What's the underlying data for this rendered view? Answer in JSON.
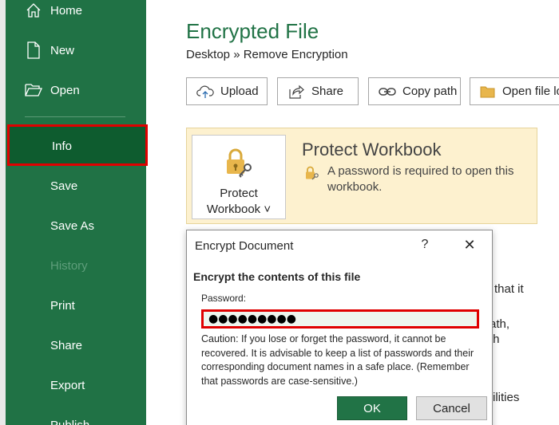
{
  "sidebar": {
    "items": [
      {
        "label": "Home",
        "icon": "home-icon"
      },
      {
        "label": "New",
        "icon": "new-document-icon"
      },
      {
        "label": "Open",
        "icon": "folder-open-icon"
      },
      {
        "label": "Info"
      },
      {
        "label": "Save"
      },
      {
        "label": "Save As"
      },
      {
        "label": "History"
      },
      {
        "label": "Print"
      },
      {
        "label": "Share"
      },
      {
        "label": "Export"
      },
      {
        "label": "Publish"
      }
    ],
    "background": "#207245",
    "selected_background": "#0e5c2f",
    "highlight_color": "#e00000"
  },
  "main": {
    "title": "Encrypted File",
    "breadcrumb": "Desktop » Remove Encryption",
    "actions": [
      {
        "label": "Upload",
        "icon": "cloud-upload-icon"
      },
      {
        "label": "Share",
        "icon": "share-icon"
      },
      {
        "label": "Copy path",
        "icon": "link-icon"
      },
      {
        "label": "Open file location",
        "icon": "folder-icon"
      }
    ],
    "protect": {
      "button_label_line1": "Protect",
      "button_label_line2": "Workbook ˅",
      "heading": "Protect Workbook",
      "description": "A password is required to open this workbook."
    },
    "background_fragments": {
      "frag1": "that it",
      "frag2": "ath,",
      "frag3": "th",
      "frag4": "ilities"
    }
  },
  "dialog": {
    "title": "Encrypt Document",
    "help": "?",
    "close": "✕",
    "heading": "Encrypt the contents of this file",
    "password_label": "Password:",
    "password_value": "●●●●●●●●●",
    "caution": "Caution: If you lose or forget the password, it cannot be recovered. It is advisable to keep a list of passwords and their corresponding document names in a safe place. (Remember that passwords are case-sensitive.)",
    "ok_label": "OK",
    "cancel_label": "Cancel"
  },
  "colors": {
    "accent": "#217346",
    "panel": "#fdf1cf"
  }
}
